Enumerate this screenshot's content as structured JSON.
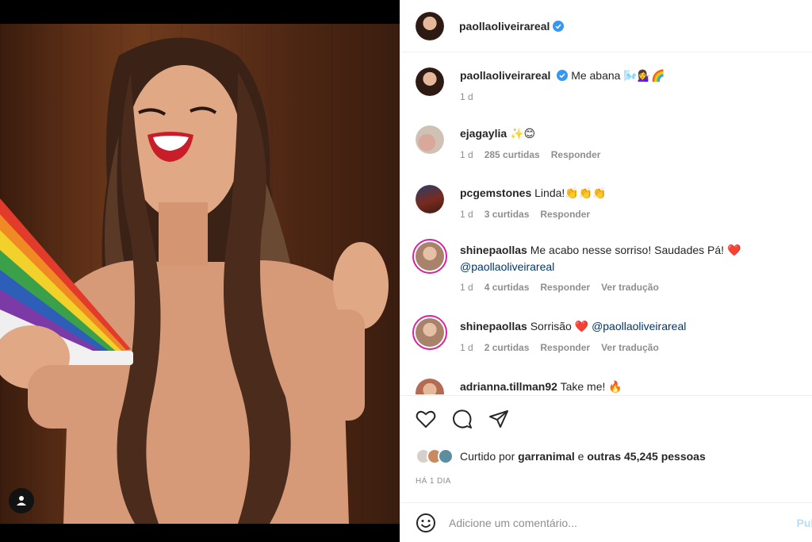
{
  "post": {
    "author": "paollaoliveirareal",
    "verified": true
  },
  "caption": {
    "author": "paollaoliveirareal",
    "text": "Me abana",
    "emoji": "🌬️💁‍♀️🌈",
    "age": "1 d"
  },
  "comments": [
    {
      "author": "ejagaylia",
      "text": "",
      "emoji": "✨😊",
      "age": "1 d",
      "likes": "285 curtidas",
      "reply": "Responder",
      "translate": "",
      "avatar_color": "#cfc2b4",
      "ring": false
    },
    {
      "author": "pcgemstones",
      "text": "Linda!",
      "emoji": "👏👏👏",
      "age": "1 d",
      "likes": "3 curtidas",
      "reply": "Responder",
      "translate": "",
      "avatar_color": "#7a2a1e",
      "ring": false
    },
    {
      "author": "shinepaollas",
      "text": "Me acabo nesse sorriso! Saudades Pá!",
      "emoji": "❤️",
      "mention": "@paollaoliveirareal",
      "age": "1 d",
      "likes": "4 curtidas",
      "reply": "Responder",
      "translate": "Ver tradução",
      "avatar_color": "#a9826c",
      "ring": true
    },
    {
      "author": "shinepaollas",
      "text": "Sorrisão",
      "emoji": "❤️",
      "mention": "@paollaoliveirareal",
      "age": "1 d",
      "likes": "2 curtidas",
      "reply": "Responder",
      "translate": "Ver tradução",
      "avatar_color": "#a9826c",
      "ring": true
    },
    {
      "author": "adrianna.tillman92",
      "text": "Take me!",
      "emoji": "🔥",
      "age": "",
      "likes": "",
      "reply": "",
      "translate": "",
      "avatar_color": "#b46b52",
      "ring": false
    }
  ],
  "likes": {
    "prefix": "Curtido por",
    "user": "garranimal",
    "joiner": "e",
    "others": "outras 45,245 pessoas"
  },
  "time_ago": "HÁ 1 DIA",
  "comment_box": {
    "placeholder": "Adicione um comentário...",
    "publish": "Pub"
  },
  "colors": {
    "verified": "#3897f0",
    "link": "#00376b",
    "muted": "#8e8e8e",
    "heart": "#ed4956",
    "publish_disabled": "#b2dffc"
  },
  "icons": [
    "heart-icon",
    "comment-icon",
    "share-icon",
    "emoji-icon",
    "user-tag-icon",
    "verified-icon"
  ]
}
